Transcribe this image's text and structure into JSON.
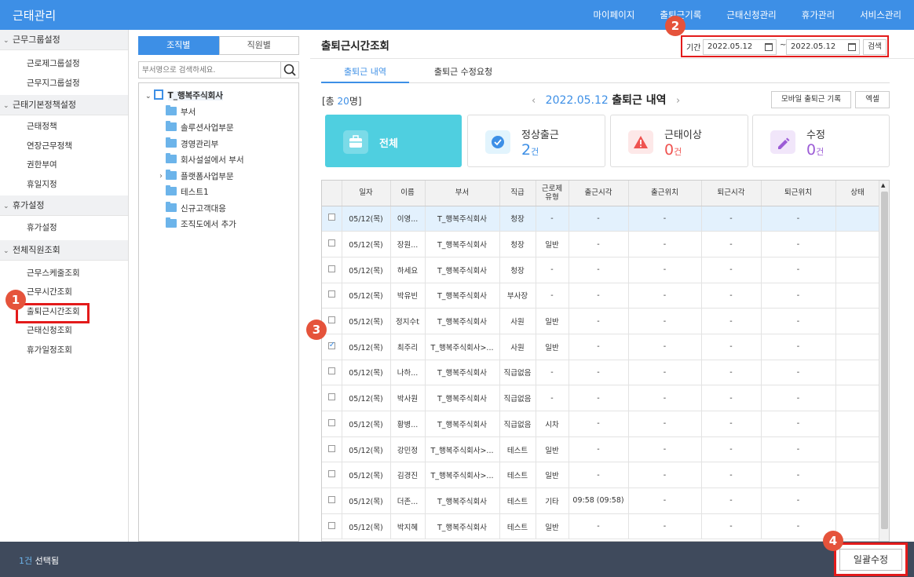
{
  "app": {
    "title": "근태관리"
  },
  "topnav": [
    "마이페이지",
    "출퇴근기록",
    "근태신청관리",
    "휴가관리",
    "서비스관리"
  ],
  "sidebar": {
    "sections": [
      {
        "label": "근무그룹설정",
        "items": [
          "근로제그룹설정",
          "근무지그룹설정"
        ]
      },
      {
        "label": "근태기본정책설정",
        "items": [
          "근태정책",
          "연장근무정책",
          "권한부여",
          "휴일지정"
        ]
      },
      {
        "label": "휴가설정",
        "items": [
          "휴가설정"
        ]
      },
      {
        "label": "전체직원조회",
        "items": [
          "근무스케줄조회",
          "근무시간조회",
          "출퇴근시간조회",
          "근태신청조회",
          "휴가일정조회"
        ]
      }
    ]
  },
  "org_panel": {
    "tab_org": "조직별",
    "tab_emp": "직원별",
    "search_placeholder": "부서명으로 검색하세요.",
    "root": "T_행복주식회사",
    "nodes": [
      "부서",
      "솔루션사업부문",
      "경영관리부",
      "회사설설에서 부서",
      "플랫폼사업부문",
      "테스트1",
      "신규고객대응",
      "조직도에서 추가"
    ]
  },
  "main": {
    "title": "출퇴근시간조회",
    "period_label": "기간",
    "date_from": "2022.05.12",
    "date_to": "2022.05.12",
    "tilde": "~",
    "search_btn": "검색",
    "tab_active": "출퇴근 내역",
    "tab_other": "출퇴근 수정요청",
    "total_prefix": "[총 ",
    "total_count": "20",
    "total_suffix": "명]",
    "nav_date": "2022.05.12",
    "nav_label": "출퇴근 내역",
    "btn_mobile": "모바일 출퇴근 기록",
    "btn_excel": "엑셀",
    "cards": [
      {
        "label": "전체",
        "value": "",
        "unit": "",
        "color": "#ffffff"
      },
      {
        "label": "정상출근",
        "value": "2",
        "unit": "건",
        "color": "#3d8fe6"
      },
      {
        "label": "근태이상",
        "value": "0",
        "unit": "건",
        "color": "#ef5350"
      },
      {
        "label": "수정",
        "value": "0",
        "unit": "건",
        "color": "#9c5cd6"
      }
    ],
    "columns": [
      "",
      "일자",
      "이름",
      "부서",
      "직급",
      "근로제\n유형",
      "출근시각",
      "출근위치",
      "퇴근시각",
      "퇴근위치",
      "상태"
    ],
    "rows": [
      [
        "05/12(목)",
        "이영...",
        "T_행복주식회사",
        "청장",
        "-",
        "-",
        "-",
        "-",
        "-",
        ""
      ],
      [
        "05/12(목)",
        "장원...",
        "T_행복주식회사",
        "청장",
        "일반",
        "-",
        "-",
        "-",
        "-",
        ""
      ],
      [
        "05/12(목)",
        "하세요",
        "T_행복주식회사",
        "청장",
        "-",
        "-",
        "-",
        "-",
        "-",
        ""
      ],
      [
        "05/12(목)",
        "박유빈",
        "T_행복주식회사",
        "부사장",
        "-",
        "-",
        "-",
        "-",
        "-",
        ""
      ],
      [
        "05/12(목)",
        "정지수t",
        "T_행복주식회사",
        "사원",
        "일반",
        "-",
        "-",
        "-",
        "-",
        ""
      ],
      [
        "05/12(목)",
        "최주리",
        "T_행복주식회사>...",
        "사원",
        "일반",
        "-",
        "-",
        "-",
        "-",
        ""
      ],
      [
        "05/12(목)",
        "나하...",
        "T_행복주식회사",
        "직급없음",
        "-",
        "-",
        "-",
        "-",
        "-",
        ""
      ],
      [
        "05/12(목)",
        "박사원",
        "T_행복주식회사",
        "직급없음",
        "-",
        "-",
        "-",
        "-",
        "-",
        ""
      ],
      [
        "05/12(목)",
        "황병...",
        "T_행복주식회사",
        "직급없음",
        "시차",
        "-",
        "-",
        "-",
        "-",
        ""
      ],
      [
        "05/12(목)",
        "강민정",
        "T_행복주식회사>...",
        "테스트",
        "일반",
        "-",
        "-",
        "-",
        "-",
        ""
      ],
      [
        "05/12(목)",
        "김경진",
        "T_행복주식회사>...",
        "테스트",
        "일반",
        "-",
        "-",
        "-",
        "-",
        ""
      ],
      [
        "05/12(목)",
        "더존...",
        "T_행복주식회사",
        "테스트",
        "기타",
        "09:58 (09:58)",
        "-",
        "-",
        "-",
        ""
      ],
      [
        "05/12(목)",
        "박지혜",
        "T_행복주식회사",
        "테스트",
        "일반",
        "-",
        "-",
        "-",
        "-",
        ""
      ]
    ],
    "selected_row": 0,
    "checked_row": 5
  },
  "footer": {
    "count": "1건",
    "label": " 선택됨",
    "bulk_btn": "일괄수정"
  },
  "badges": [
    "1",
    "2",
    "3",
    "4"
  ]
}
